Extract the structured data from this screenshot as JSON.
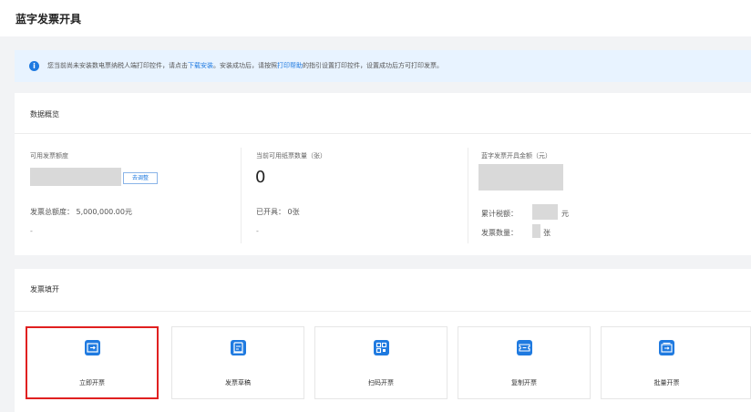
{
  "header": {
    "title": "蓝字发票开具"
  },
  "notice": {
    "text_before": "您当前尚未安装数电票纳税人端打印控件，请点击",
    "link_download": "下载安装",
    "text_middle": "。安装成功后，请按照",
    "link_help": "打印帮助",
    "text_after": "的指引设置打印控件，设置成功后方可打印发票。"
  },
  "overview": {
    "title": "数据概览",
    "available_quota": {
      "label": "可用发票额度",
      "adjust_label": "去调整",
      "total_text": "发票总额度： 5,000,000.00元",
      "footer": "-"
    },
    "paper_count": {
      "label": "当前可用纸票数量（张）",
      "value": "0",
      "issued_text": "已开具： 0张",
      "footer": "-"
    },
    "blue_amount": {
      "label": "蓝字发票开具金额（元）",
      "tax_label": "累计税额：",
      "tax_unit": "元",
      "count_label": "发票数量：",
      "count_unit": "张"
    }
  },
  "issue": {
    "title": "发票填开",
    "tiles": [
      {
        "label": "立即开票",
        "icon": "instant-issue-icon"
      },
      {
        "label": "发票草稿",
        "icon": "draft-icon"
      },
      {
        "label": "扫码开票",
        "icon": "qr-code-icon"
      },
      {
        "label": "复制开票",
        "icon": "copy-ticket-icon"
      },
      {
        "label": "批量开票",
        "icon": "batch-issue-icon"
      }
    ]
  },
  "colors": {
    "accent": "#1f7ae0",
    "highlight": "#e02020",
    "notice_bg": "#e8f3ff"
  }
}
